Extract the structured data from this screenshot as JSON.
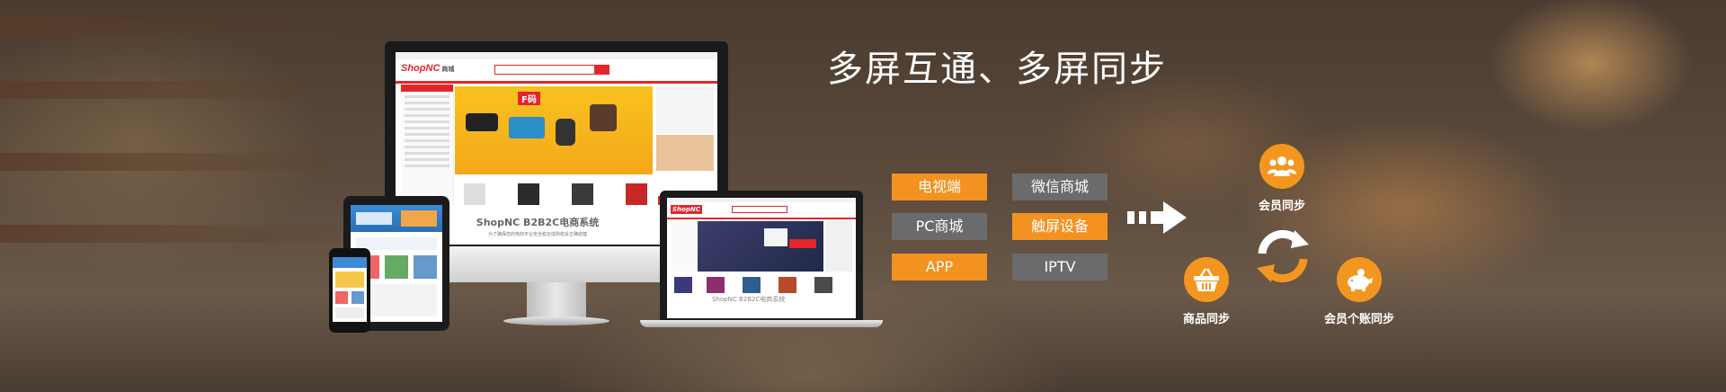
{
  "title": "多屏互通、多屏同步",
  "tags": [
    {
      "label": "电视端",
      "color": "#f39221"
    },
    {
      "label": "微信商城",
      "color": "#6b6b6b"
    },
    {
      "label": "PC商城",
      "color": "#6b6b6b"
    },
    {
      "label": "触屏设备",
      "color": "#f39221"
    },
    {
      "label": "APP",
      "color": "#f39221"
    },
    {
      "label": "IPTV",
      "color": "#6b6b6b"
    }
  ],
  "sync": {
    "member": "会员同步",
    "product": "商品同步",
    "account": "会员个账同步"
  },
  "devices": {
    "monitor_logo": "ShopNC",
    "monitor_logo_sub": "商城",
    "monitor_caption": "ShopNC B2B2C电商系统",
    "monitor_caption_sub": "为了确保您的电商平台安全稳定成熟稳妥正确稳健",
    "monitor_promo": "F码",
    "laptop_logo": "ShopNC",
    "laptop_caption": "ShopNC B2B2C电商系统"
  },
  "colors": {
    "accent": "#f39221",
    "gray_tag": "#6b6b6b",
    "brand_red": "#e4262a"
  }
}
